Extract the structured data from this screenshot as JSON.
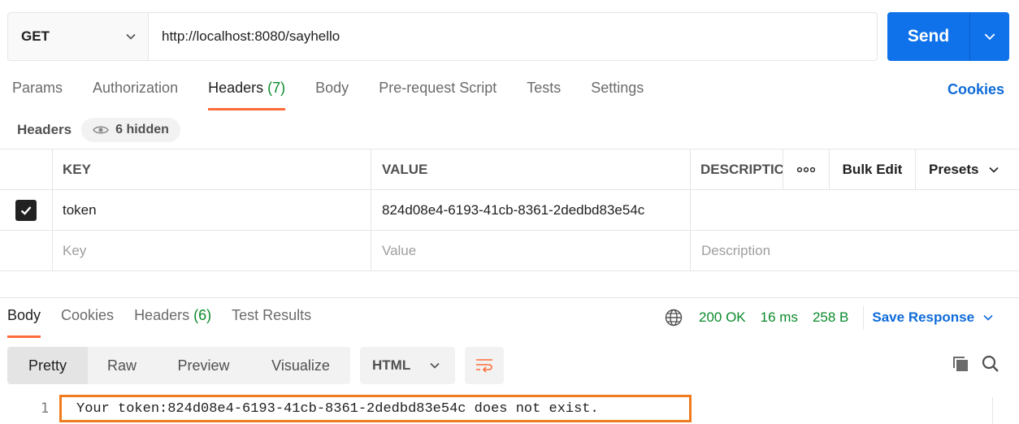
{
  "request": {
    "method": "GET",
    "url": "http://localhost:8080/sayhello",
    "send_label": "Send"
  },
  "request_tabs": [
    {
      "label": "Params",
      "count": ""
    },
    {
      "label": "Authorization",
      "count": ""
    },
    {
      "label": "Headers",
      "count": "(7)",
      "active": true
    },
    {
      "label": "Body",
      "count": ""
    },
    {
      "label": "Pre-request Script",
      "count": ""
    },
    {
      "label": "Tests",
      "count": ""
    },
    {
      "label": "Settings",
      "count": ""
    }
  ],
  "cookies_label": "Cookies",
  "headers_section": {
    "title": "Headers",
    "hidden_label": "6 hidden"
  },
  "table": {
    "columns": {
      "key": "KEY",
      "value": "VALUE",
      "description": "DESCRIPTIC",
      "bulk_edit": "Bulk Edit",
      "presets": "Presets"
    },
    "rows": [
      {
        "checked": true,
        "key": "token",
        "value": "824d08e4-6193-41cb-8361-2dedbd83e54c",
        "description": ""
      }
    ],
    "placeholders": {
      "key": "Key",
      "value": "Value",
      "description": "Description"
    }
  },
  "response_tabs": [
    {
      "label": "Body",
      "count": "",
      "active": true
    },
    {
      "label": "Cookies",
      "count": ""
    },
    {
      "label": "Headers",
      "count": "(6)"
    },
    {
      "label": "Test Results",
      "count": ""
    }
  ],
  "response_status": {
    "status": "200 OK",
    "time": "16 ms",
    "size": "258 B",
    "save_label": "Save Response"
  },
  "view_modes": [
    "Pretty",
    "Raw",
    "Preview",
    "Visualize"
  ],
  "language": "HTML",
  "response_body": {
    "line_number": "1",
    "text": "Your token:824d08e4-6193-41cb-8361-2dedbd83e54c does not exist."
  },
  "colors": {
    "accent": "#ff6c37",
    "send": "#0f72ea",
    "link": "#0f6bd9",
    "success": "#0b8a2c",
    "highlight_box": "#f07b1f"
  }
}
